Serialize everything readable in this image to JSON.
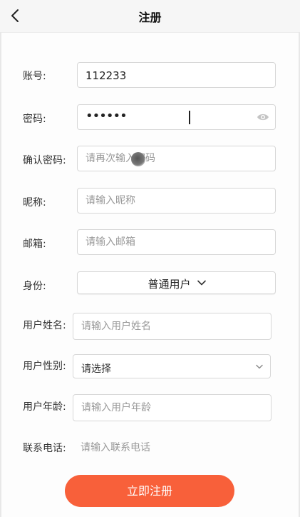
{
  "header": {
    "title": "注册"
  },
  "form": {
    "account": {
      "label": "账号:",
      "value": "112233"
    },
    "password": {
      "label": "密码:",
      "masked_value": "••••••"
    },
    "confirm_password": {
      "label": "确认密码:",
      "placeholder": "请再次输入密码"
    },
    "nickname": {
      "label": "昵称:",
      "placeholder": "请输入昵称"
    },
    "email": {
      "label": "邮箱:",
      "placeholder": "请输入邮箱"
    },
    "role": {
      "label": "身份:",
      "selected": "普通用户"
    },
    "user_name": {
      "label": "用户姓名:",
      "placeholder": "请输入用户姓名"
    },
    "user_gender": {
      "label": "用户性别:",
      "selected": "请选择"
    },
    "user_age": {
      "label": "用户年龄:",
      "placeholder": "请输入用户年龄"
    },
    "contact_phone": {
      "label": "联系电话:",
      "placeholder": "请输入联系电话"
    }
  },
  "submit_label": "立即注册",
  "colors": {
    "accent": "#f8603a"
  },
  "icons": {
    "back": "chevron-left-icon",
    "password_toggle": "eye-icon",
    "dropdown": "chevron-down-icon"
  }
}
